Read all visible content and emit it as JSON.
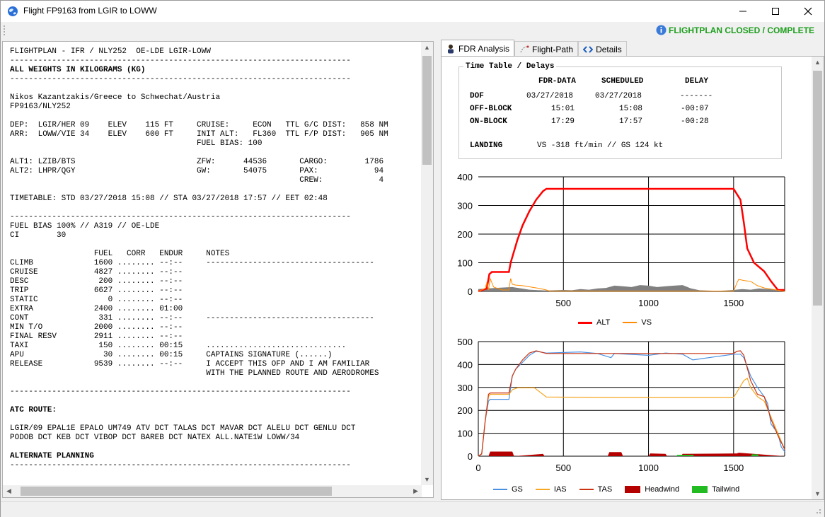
{
  "window": {
    "title": "Flight FP9163 from LGIR to LOWW",
    "status": "FLIGHTPLAN CLOSED / COMPLETE",
    "status_color": "#1d9e1d"
  },
  "flightplan_text": {
    "line01": "FLIGHTPLAN - IFR / NLY252  OE-LDE LGIR-LOWW",
    "line02": "-------------------------------------------------------------------------",
    "line03": "ALL WEIGHTS IN KILOGRAMS (KG)",
    "line04": "-------------------------------------------------------------------------",
    "line05": "",
    "line06": "Nikos Kazantzakis/Greece to Schwechat/Austria",
    "line07": "FP9163/NLY252",
    "line08": "",
    "line09": "DEP:  LGIR/HER 09    ELEV    115 FT     CRUISE:     ECON   TTL G/C DIST:   858 NM",
    "line10": "ARR:  LOWW/VIE 34    ELEV    600 FT     INIT ALT:   FL360  TTL F/P DIST:   905 NM",
    "line11": "                                        FUEL BIAS: 100",
    "line12": "",
    "line13": "ALT1: LZIB/BTS                          ZFW:      44536       CARGO:        1786",
    "line14": "ALT2: LHPR/QGY                          GW:       54075       PAX:            94",
    "line15": "                                                              CREW:            4",
    "line16": "",
    "line17": "TIMETABLE: STD 03/27/2018 15:08 // STA 03/27/2018 17:57 // EET 02:48",
    "line18": "",
    "line19": "-------------------------------------------------------------------------",
    "line20": "FUEL BIAS 100% // A319 // OE-LDE",
    "line21": "CI        30",
    "line22": "",
    "line23": "                  FUEL   CORR   ENDUR     NOTES",
    "line24": "CLIMB             1600 ........ --:--     ------------------------------------",
    "line25": "CRUISE            4827 ........ --:--",
    "line26": "DESC               200 ........ --:--",
    "line27": "TRIP              6627 ........ --:--",
    "line28": "STATIC               0 ........ --:--",
    "line29": "EXTRA             2400 ........ 01:00",
    "line30": "CONT               331 ........ --:--     ------------------------------------",
    "line31": "MIN T/O           2000 ........ --:--",
    "line32": "FINAL RESV        2911 ........ --:--",
    "line33": "TAXI               150 ........ 00:15     ..............................",
    "line34": "APU                 30 ........ 00:15     CAPTAINS SIGNATURE (......)",
    "line35": "RELEASE           9539 ........ --:--     I ACCEPT THIS OFP AND I AM FAMILIAR",
    "line36": "                                          WITH THE PLANNED ROUTE AND AERODROMES",
    "line37": "",
    "line38": "-------------------------------------------------------------------------",
    "line39": "",
    "line40": "ATC ROUTE:",
    "line41": "",
    "line42": "LGIR/09 EPAL1E EPALO UM749 ATV DCT TALAS DCT MAVAR DCT ALELU DCT GENLU DCT",
    "line43": "PODOB DCT KEB DCT VIBOP DCT BAREB DCT NATEX ALL.NATE1W LOWW/34",
    "line44": "",
    "line45": "ALTERNATE PLANNING",
    "line46": "-------------------------------------------------------------------------"
  },
  "tabs": {
    "fdr": "FDR Analysis",
    "path": "Flight-Path",
    "details": "Details"
  },
  "timetable": {
    "title": "Time Table / Delays",
    "col_fdr": "FDR-DATA",
    "col_sched": "SCHEDULED",
    "col_delay": "DELAY",
    "dof_label": "DOF",
    "dof_fdr": "03/27/2018",
    "dof_sched": "03/27/2018",
    "dof_delay": "-------",
    "off_label": "OFF-BLOCK",
    "off_fdr": "15:01",
    "off_sched": "15:08",
    "off_delay": "-00:07",
    "on_label": "ON-BLOCK",
    "on_fdr": "17:29",
    "on_sched": "17:57",
    "on_delay": "-00:28",
    "landing_label": "LANDING",
    "landing_value": "VS -318 ft/min // GS 124 kt"
  },
  "chart_data": [
    {
      "type": "line",
      "title": "",
      "xlim": [
        0,
        1800
      ],
      "ylim": [
        0,
        400
      ],
      "xticks": [
        "500",
        "1000",
        "1500"
      ],
      "yticks": [
        "0",
        "100",
        "200",
        "300",
        "400"
      ],
      "grid": true,
      "legend_position": "bottom",
      "series": [
        {
          "name": "ALT",
          "color": "#ff0000",
          "x": [
            0,
            50,
            65,
            80,
            180,
            190,
            230,
            260,
            300,
            340,
            380,
            400,
            800,
            1200,
            1500,
            1540,
            1560,
            1580,
            1620,
            1680,
            1720,
            1760,
            1800
          ],
          "y": [
            0,
            10,
            60,
            68,
            68,
            100,
            180,
            230,
            280,
            320,
            350,
            358,
            358,
            358,
            358,
            320,
            240,
            150,
            100,
            70,
            35,
            5,
            5
          ]
        },
        {
          "name": "VS",
          "color": "#ff8c00",
          "x": [
            0,
            40,
            50,
            60,
            70,
            90,
            140,
            180,
            190,
            200,
            220,
            260,
            300,
            360,
            400,
            420,
            1500,
            1520,
            1530,
            1560,
            1600,
            1640,
            1680,
            1720,
            1760,
            1800
          ],
          "y": [
            0,
            10,
            30,
            5,
            45,
            15,
            5,
            5,
            45,
            25,
            22,
            20,
            16,
            10,
            5,
            1,
            1,
            30,
            42,
            38,
            35,
            20,
            12,
            8,
            4,
            0
          ]
        },
        {
          "name": "",
          "color": "#808080",
          "x": [
            0,
            100,
            200,
            300,
            400,
            500,
            550,
            600,
            650,
            700,
            750,
            800,
            850,
            900,
            950,
            1000,
            1050,
            1100,
            1150,
            1200,
            1250,
            1300,
            1400,
            1450,
            1500,
            1550,
            1600,
            1650,
            1700,
            1750,
            1800
          ],
          "y": [
            8,
            12,
            15,
            6,
            3,
            5,
            4,
            8,
            6,
            10,
            12,
            20,
            18,
            15,
            22,
            20,
            15,
            18,
            20,
            22,
            10,
            4,
            2,
            3,
            5,
            8,
            6,
            10,
            8,
            6,
            0
          ]
        }
      ]
    },
    {
      "type": "line",
      "title": "",
      "xlim": [
        0,
        1800
      ],
      "ylim": [
        0,
        500
      ],
      "xticks": [
        "0",
        "500",
        "1000",
        "1500"
      ],
      "yticks": [
        "0",
        "100",
        "200",
        "300",
        "400",
        "500"
      ],
      "grid": true,
      "legend_position": "bottom",
      "series": [
        {
          "name": "GS",
          "color": "#4a90e2",
          "x": [
            0,
            20,
            40,
            60,
            70,
            180,
            200,
            220,
            260,
            300,
            340,
            400,
            600,
            700,
            780,
            800,
            1000,
            1100,
            1200,
            1260,
            1500,
            1520,
            1540,
            1560,
            1600,
            1640,
            1680,
            1700,
            1720,
            1760,
            1780,
            1800
          ],
          "y": [
            0,
            10,
            150,
            240,
            248,
            248,
            350,
            380,
            410,
            440,
            458,
            450,
            455,
            448,
            430,
            448,
            440,
            450,
            445,
            420,
            445,
            445,
            445,
            430,
            350,
            300,
            260,
            230,
            140,
            100,
            40,
            20
          ]
        },
        {
          "name": "IAS",
          "color": "#f5a623",
          "x": [
            0,
            20,
            40,
            60,
            70,
            180,
            200,
            230,
            330,
            400,
            800,
            1200,
            1500,
            1520,
            1560,
            1580,
            1600,
            1640,
            1680,
            1720,
            1760,
            1800
          ],
          "y": [
            0,
            10,
            150,
            260,
            270,
            270,
            290,
            298,
            298,
            258,
            256,
            256,
            256,
            280,
            330,
            340,
            300,
            260,
            240,
            170,
            100,
            30
          ]
        },
        {
          "name": "TAS",
          "color": "#cc3311",
          "x": [
            0,
            20,
            40,
            60,
            70,
            180,
            200,
            220,
            260,
            300,
            340,
            400,
            800,
            1200,
            1500,
            1520,
            1540,
            1560,
            1600,
            1640,
            1680,
            1720,
            1760,
            1800
          ],
          "y": [
            0,
            10,
            150,
            270,
            276,
            276,
            350,
            380,
            420,
            450,
            460,
            448,
            448,
            448,
            448,
            458,
            460,
            440,
            330,
            270,
            260,
            160,
            90,
            30
          ]
        },
        {
          "name": "Headwind",
          "color": "#b50000",
          "x": [
            0,
            60,
            70,
            200,
            210,
            380,
            390,
            760,
            770,
            840,
            850,
            1000,
            1010,
            1100,
            1110,
            1190,
            1200,
            1520,
            1530,
            1800
          ],
          "y": [
            0,
            0,
            20,
            20,
            0,
            10,
            0,
            0,
            18,
            18,
            0,
            0,
            12,
            10,
            0,
            0,
            10,
            12,
            15,
            0
          ]
        },
        {
          "name": "Tailwind",
          "color": "#22bb22",
          "x": [
            1160,
            1170,
            1260,
            1270,
            1600,
            1610,
            1640,
            1650
          ],
          "y": [
            0,
            6,
            6,
            0,
            0,
            8,
            8,
            0
          ]
        }
      ]
    }
  ]
}
